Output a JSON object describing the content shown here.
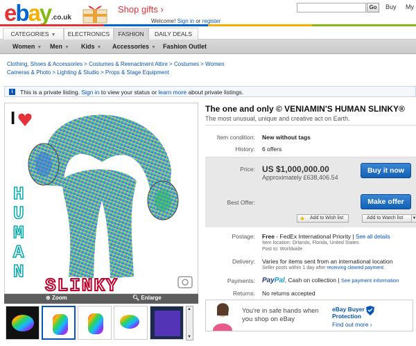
{
  "header": {
    "logo_letters": [
      "e",
      "b",
      "a",
      "y"
    ],
    "logo_tld": ".co.uk",
    "promo": "Shop gifts",
    "promo_arrow": "›",
    "welcome_text": "Welcome!",
    "sign_in": "Sign in",
    "or": "or",
    "register": "register",
    "search_go": "Go",
    "buy": "Buy",
    "my_ebay": "My e"
  },
  "tabs": [
    {
      "label": "CATEGORIES",
      "caret": true
    },
    {
      "label": "ELECTRONICS",
      "caret": false
    },
    {
      "label": "FASHION",
      "caret": false,
      "active": true
    },
    {
      "label": "DAILY DEALS",
      "caret": false
    }
  ],
  "subnav": [
    {
      "label": "Women"
    },
    {
      "label": "Men"
    },
    {
      "label": "Kids"
    },
    {
      "label": "Accessories"
    },
    {
      "label": "Fashion Outlet"
    }
  ],
  "breadcrumb_line1": "Clothing, Shoes & Accessories > Costumes & Reenactment Attire > Costumes > Women",
  "breadcrumb_line2": "Cameras & Photo > Lighting & Studio > Props & Stage Equipment",
  "private_notice": {
    "before": "This is a private listing.",
    "sign_in": "Sign in",
    "middle": "to view your status or",
    "learn_more": "learn more",
    "after": "about private listings."
  },
  "image": {
    "text_top": "I",
    "text_side": [
      "H",
      "U",
      "M",
      "A",
      "N"
    ],
    "text_bottom": "SLINKY",
    "zoom": "Zoom",
    "enlarge": "Enlarge"
  },
  "item": {
    "title": "The one and only © VENIAMIN'S HUMAN SLINKY®",
    "subtitle": "The most unusual, unique and creative act on Earth.",
    "condition_label": "Item condition:",
    "condition": "New without tags",
    "history_label": "History:",
    "history": "6 offers",
    "price_label": "Price:",
    "price": "US $1,000,000.00",
    "approx": "Approximately £638,406.54",
    "buy_now": "Buy it now",
    "add_wish": "Add to Wish list",
    "best_offer_label": "Best Offer:",
    "make_offer": "Make offer",
    "add_watch": "Add to Watch list",
    "postage_label": "Postage:",
    "postage_free": "Free",
    "postage_service": "- FedEx International Priority",
    "see_all": "See all details",
    "item_location": "Item location: Orlando, Florida, United States",
    "post_to": "Post to: Worldwide",
    "delivery_label": "Delivery:",
    "delivery": "Varies for items sent from an international location",
    "dispatch_before": "Seller posts within 1 day after",
    "dispatch_link": "receiving cleared payment",
    "dispatch_after": ".",
    "payments_label": "Payments:",
    "paypal_pay": "Pay",
    "paypal_pal": "Pal",
    "payments_cash": ", Cash on collection",
    "payments_link": "See payment information",
    "returns_label": "Returns:",
    "returns": "No returns accepted"
  },
  "safe": {
    "line1": "You're in safe hands when",
    "line2": "you shop on eBay",
    "protection_title": "eBay Buyer",
    "protection_title2": "Protection",
    "find_more": "Find out more ›"
  },
  "colors": {
    "ebay_red": "#e53238",
    "ebay_blue": "#0064d2",
    "ebay_yellow": "#f5af02",
    "ebay_green": "#86b817",
    "link_blue": "#0654ba",
    "button_blue": "#1261b7"
  }
}
